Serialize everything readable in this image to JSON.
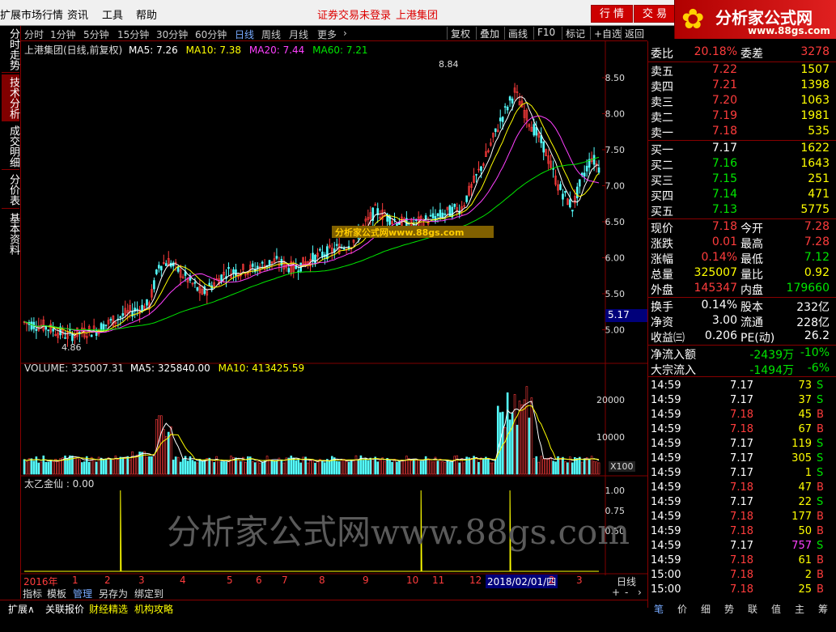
{
  "menu": {
    "items": [
      "扩展市场行情",
      "资讯",
      "工具",
      "帮助"
    ],
    "login_notice": "证券交易未登录",
    "stock_title": "上港集团",
    "btn_quote": "行 情",
    "btn_trade": "交 易"
  },
  "logo": {
    "name": "分析家公式网",
    "url": "www.88gs.com"
  },
  "left_tabs": [
    "分时走势",
    "技术分析",
    "成交明细",
    "分价表",
    "基本资料"
  ],
  "period_tabs": [
    "分时",
    "1分钟",
    "5分钟",
    "15分钟",
    "30分钟",
    "60分钟",
    "日线",
    "周线",
    "月线",
    "更多"
  ],
  "toolbar": [
    "复权",
    "叠加",
    "画线",
    "F10",
    "标记",
    "+自选",
    "返回"
  ],
  "main_legend": {
    "title": "上港集团(日线,前复权)",
    "ma5": "MA5: 7.26",
    "ma10": "MA10: 7.38",
    "ma20": "MA20: 7.44",
    "ma60": "MA60: 7.21"
  },
  "price_axis": [
    "8.50",
    "8.00",
    "7.50",
    "7.00",
    "6.50",
    "6.00",
    "5.50",
    "5.00"
  ],
  "current_price_tag": "5.17",
  "high_label": "8.84",
  "low_label": "4.86",
  "watermark_small": "分析家公式网www.88gs.com",
  "watermark_big": "分析家公式网www.88gs.com",
  "volume_legend": {
    "vol": "VOLUME: 325007.31",
    "ma5": "MA5: 325840.00",
    "ma10": "MA10: 413425.59"
  },
  "volume_axis": [
    "20000",
    "10000"
  ],
  "volume_unit": "X100",
  "ind_legend": "太乙金仙 : 0.00",
  "ind_axis": [
    "1.00",
    "0.75",
    "0.50"
  ],
  "date_axis": {
    "year": "2016年",
    "months": [
      "1",
      "2",
      "3",
      "4",
      "5",
      "6",
      "7",
      "8",
      "9",
      "10",
      "11",
      "12",
      "2",
      "3"
    ],
    "highlight": "2018/02/01/四",
    "period": "日线"
  },
  "bottom_tabs": [
    "指标",
    "模板",
    "管理",
    "另存为",
    "绑定到"
  ],
  "status_tabs": [
    "扩展∧",
    "关联报价",
    "财经精选",
    "机构攻略"
  ],
  "right_bottom_tabs": [
    "笔",
    "价",
    "细",
    "势",
    "联",
    "值",
    "主",
    "筹"
  ],
  "quote": {
    "weibi": {
      "label": "委比",
      "value": "20.18%",
      "label2": "委差",
      "value2": "3278"
    },
    "asks": [
      {
        "label": "卖五",
        "price": "7.22",
        "vol": "1507"
      },
      {
        "label": "卖四",
        "price": "7.21",
        "vol": "1398"
      },
      {
        "label": "卖三",
        "price": "7.20",
        "vol": "1063"
      },
      {
        "label": "卖二",
        "price": "7.19",
        "vol": "1981"
      },
      {
        "label": "卖一",
        "price": "7.18",
        "vol": "535"
      }
    ],
    "bids": [
      {
        "label": "买一",
        "price": "7.17",
        "vol": "1622"
      },
      {
        "label": "买二",
        "price": "7.16",
        "vol": "1643"
      },
      {
        "label": "买三",
        "price": "7.15",
        "vol": "251"
      },
      {
        "label": "买四",
        "price": "7.14",
        "vol": "471"
      },
      {
        "label": "买五",
        "price": "7.13",
        "vol": "5775"
      }
    ],
    "stats": [
      {
        "l1": "现价",
        "v1": "7.18",
        "l2": "今开",
        "v2": "7.28"
      },
      {
        "l1": "涨跌",
        "v1": "0.01",
        "l2": "最高",
        "v2": "7.28"
      },
      {
        "l1": "涨幅",
        "v1": "0.14%",
        "l2": "最低",
        "v2": "7.12"
      },
      {
        "l1": "总量",
        "v1": "325007",
        "l2": "量比",
        "v2": "0.92"
      },
      {
        "l1": "外盘",
        "v1": "145347",
        "l2": "内盘",
        "v2": "179660"
      }
    ],
    "stats2": [
      {
        "l1": "换手",
        "v1": "0.14%",
        "l2": "股本",
        "v2": "232亿"
      },
      {
        "l1": "净资",
        "v1": "3.00",
        "l2": "流通",
        "v2": "228亿"
      },
      {
        "l1": "收益㈢",
        "v1": "0.206",
        "l2": "PE(动)",
        "v2": "26.2"
      }
    ],
    "flow": [
      {
        "label": "净流入额",
        "value": "-2439万",
        "pct": "-10%"
      },
      {
        "label": "大宗流入",
        "value": "-1494万",
        "pct": "-6%"
      }
    ],
    "ticks": [
      {
        "t": "14:59",
        "p": "7.17",
        "v": "73",
        "s": "S"
      },
      {
        "t": "14:59",
        "p": "7.17",
        "v": "37",
        "s": "S"
      },
      {
        "t": "14:59",
        "p": "7.18",
        "v": "45",
        "s": "B"
      },
      {
        "t": "14:59",
        "p": "7.18",
        "v": "67",
        "s": "B"
      },
      {
        "t": "14:59",
        "p": "7.17",
        "v": "119",
        "s": "S"
      },
      {
        "t": "14:59",
        "p": "7.17",
        "v": "305",
        "s": "S"
      },
      {
        "t": "14:59",
        "p": "7.17",
        "v": "1",
        "s": "S"
      },
      {
        "t": "14:59",
        "p": "7.18",
        "v": "47",
        "s": "B"
      },
      {
        "t": "14:59",
        "p": "7.17",
        "v": "22",
        "s": "S"
      },
      {
        "t": "14:59",
        "p": "7.18",
        "v": "177",
        "s": "B"
      },
      {
        "t": "14:59",
        "p": "7.18",
        "v": "50",
        "s": "B"
      },
      {
        "t": "14:59",
        "p": "7.17",
        "v": "757",
        "s": "S"
      },
      {
        "t": "14:59",
        "p": "7.18",
        "v": "61",
        "s": "B"
      },
      {
        "t": "15:00",
        "p": "7.18",
        "v": "2",
        "s": "B"
      },
      {
        "t": "15:00",
        "p": "7.18",
        "v": "25",
        "s": "B"
      }
    ]
  }
}
